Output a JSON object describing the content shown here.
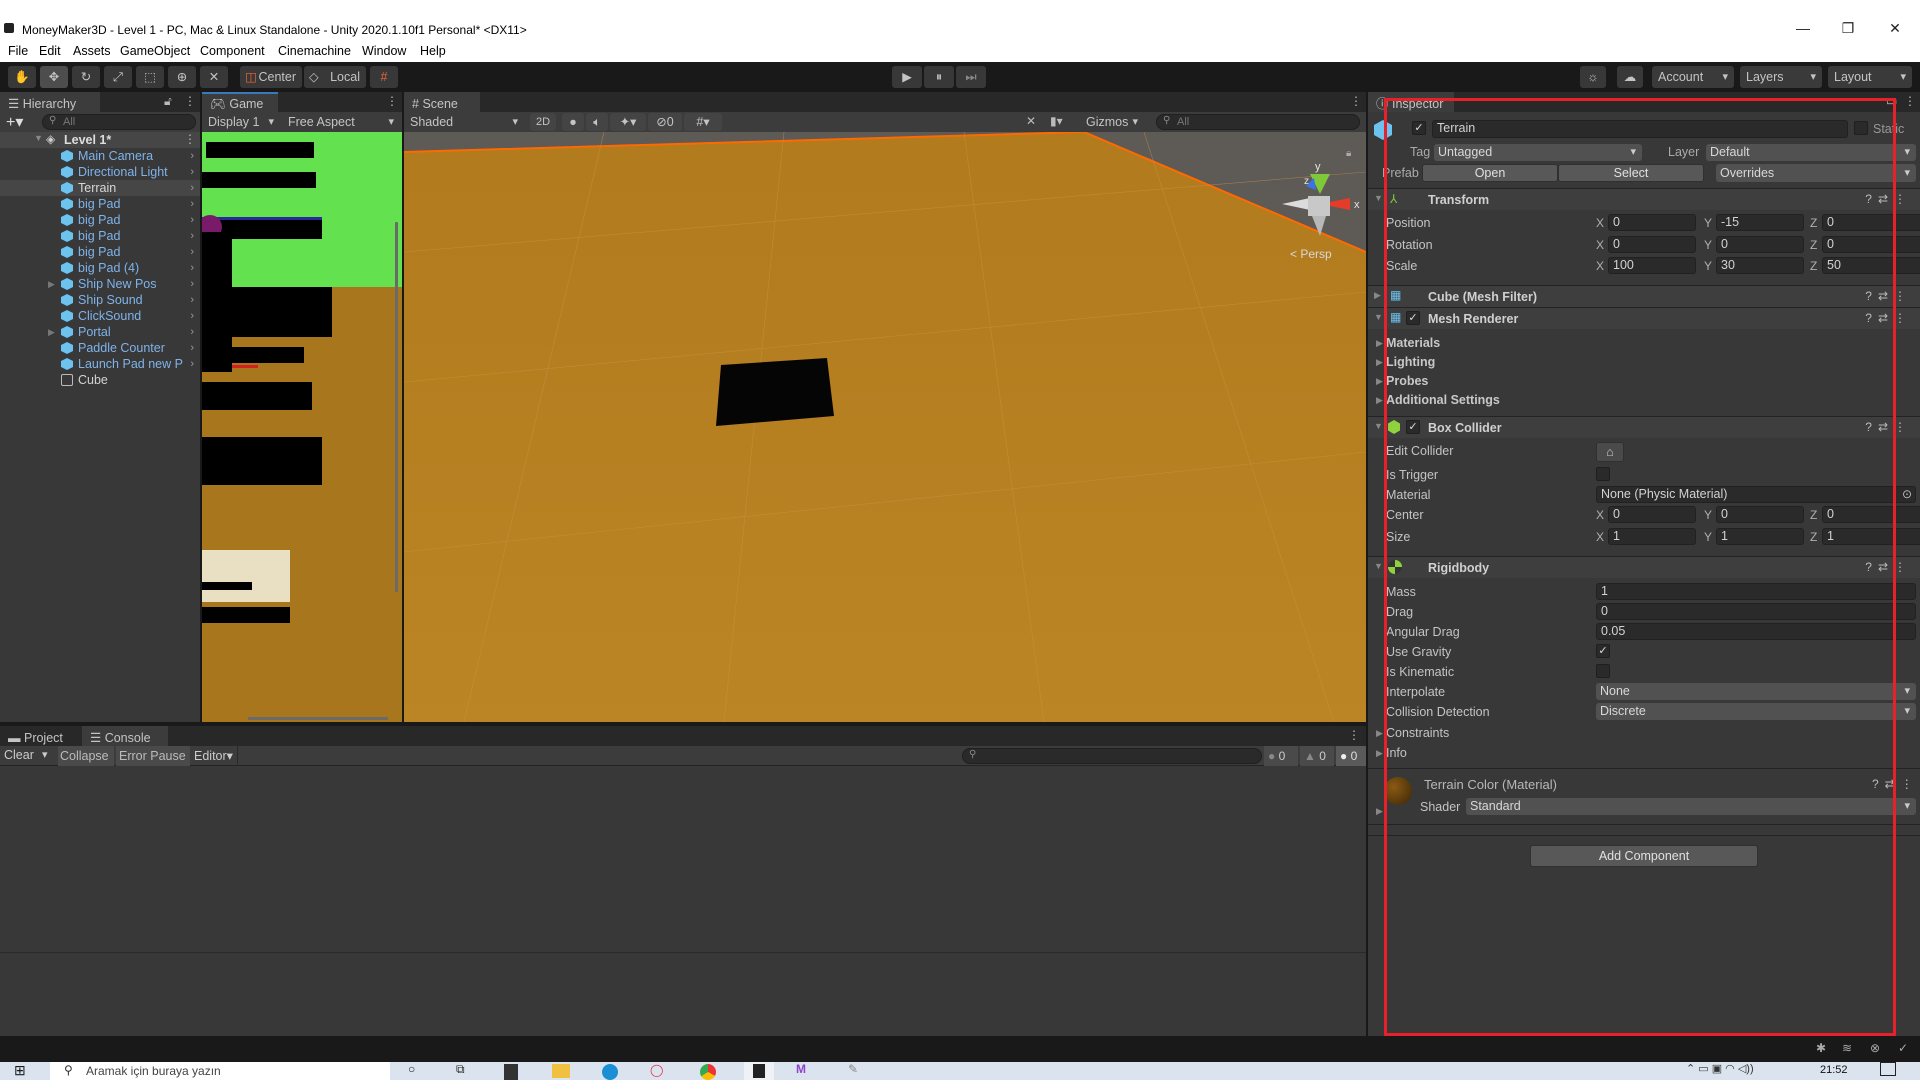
{
  "window": {
    "title": "MoneyMaker3D - Level 1 - PC, Mac & Linux Standalone - Unity 2020.1.10f1 Personal* <DX11>",
    "controls": [
      "—",
      "❐",
      "✕"
    ]
  },
  "menu": [
    "File",
    "Edit",
    "Assets",
    "GameObject",
    "Component",
    "Cinemachine",
    "Window",
    "Help"
  ],
  "toolbar": {
    "tools": [
      "hand-tool",
      "move-tool",
      "rotate-tool",
      "scale-tool",
      "rect-tool",
      "transform-tool",
      "custom-tool"
    ],
    "pivot_mode": "Center",
    "pivot_space": "Local",
    "play": "▶",
    "pause": "⏸",
    "step": "⏭",
    "account": "Account",
    "layers": "Layers",
    "layout": "Layout"
  },
  "hierarchy": {
    "tab": "Hierarchy",
    "search_placeholder": "All",
    "scene": "Level 1*",
    "items": [
      {
        "label": "Main Camera",
        "fold": false
      },
      {
        "label": "Directional Light",
        "fold": false
      },
      {
        "label": "Terrain",
        "fold": false,
        "selected": true
      },
      {
        "label": "big Pad",
        "fold": false
      },
      {
        "label": "big Pad",
        "fold": false
      },
      {
        "label": "big Pad",
        "fold": false
      },
      {
        "label": "big Pad",
        "fold": false
      },
      {
        "label": "big Pad (4)",
        "fold": false
      },
      {
        "label": "Ship New Pos",
        "fold": true
      },
      {
        "label": "Ship Sound",
        "fold": false
      },
      {
        "label": "ClickSound",
        "fold": false
      },
      {
        "label": "Portal",
        "fold": true
      },
      {
        "label": "Paddle Counter",
        "fold": false
      },
      {
        "label": "Launch Pad new P",
        "fold": false
      },
      {
        "label": "Cube",
        "fold": false,
        "plain": true
      }
    ]
  },
  "game": {
    "tab": "Game",
    "display": "Display 1",
    "aspect": "Free Aspect"
  },
  "scene": {
    "tab": "Scene",
    "shading": "Shaded",
    "mode_2d": "2D",
    "hidden_count": "0",
    "gizmos": "Gizmos",
    "search_placeholder": "All",
    "projection": "Persp",
    "axes": {
      "x": "x",
      "y": "y",
      "z": "z"
    }
  },
  "console": {
    "tabs": [
      "Project",
      "Console"
    ],
    "clear": "Clear",
    "collapse": "Collapse",
    "error_pause": "Error Pause",
    "editor": "Editor",
    "log_count": "0",
    "warning_count": "0",
    "error_count": "0"
  },
  "inspector": {
    "tab": "Inspector",
    "object_name": "Terrain",
    "static_label": "Static",
    "tag_label": "Tag",
    "tag": "Untagged",
    "layer_label": "Layer",
    "layer": "Default",
    "prefab_label": "Prefab",
    "prefab_open": "Open",
    "prefab_select": "Select",
    "prefab_overrides": "Overrides",
    "transform": {
      "title": "Transform",
      "position": {
        "label": "Position",
        "x": "0",
        "y": "-15",
        "z": "0"
      },
      "rotation": {
        "label": "Rotation",
        "x": "0",
        "y": "0",
        "z": "0"
      },
      "scale": {
        "label": "Scale",
        "x": "100",
        "y": "30",
        "z": "50"
      }
    },
    "mesh_filter": {
      "title": "Cube (Mesh Filter)"
    },
    "mesh_renderer": {
      "title": "Mesh Renderer",
      "sections": [
        "Materials",
        "Lighting",
        "Probes",
        "Additional Settings"
      ]
    },
    "box_collider": {
      "title": "Box Collider",
      "edit_collider": "Edit Collider",
      "is_trigger": "Is Trigger",
      "material_label": "Material",
      "material": "None (Physic Material)",
      "center": {
        "label": "Center",
        "x": "0",
        "y": "0",
        "z": "0"
      },
      "size": {
        "label": "Size",
        "x": "1",
        "y": "1",
        "z": "1"
      }
    },
    "rigidbody": {
      "title": "Rigidbody",
      "mass_label": "Mass",
      "mass": "1",
      "drag_label": "Drag",
      "drag": "0",
      "angular_drag_label": "Angular Drag",
      "angular_drag": "0.05",
      "use_gravity_label": "Use Gravity",
      "use_gravity": true,
      "is_kinematic_label": "Is Kinematic",
      "is_kinematic": false,
      "interpolate_label": "Interpolate",
      "interpolate": "None",
      "collision_label": "Collision Detection",
      "collision": "Discrete",
      "constraints": "Constraints",
      "info": "Info"
    },
    "material": {
      "title": "Terrain Color (Material)",
      "shader_label": "Shader",
      "shader": "Standard"
    },
    "add_component": "Add Component"
  },
  "taskbar": {
    "search_placeholder": "Aramak için buraya yazın",
    "time": "21:52"
  },
  "colors": {
    "highlight_box": "#e8202a",
    "terrain": "#b5801f",
    "game_sky": "#63e14f",
    "selection": "#e06a14"
  }
}
